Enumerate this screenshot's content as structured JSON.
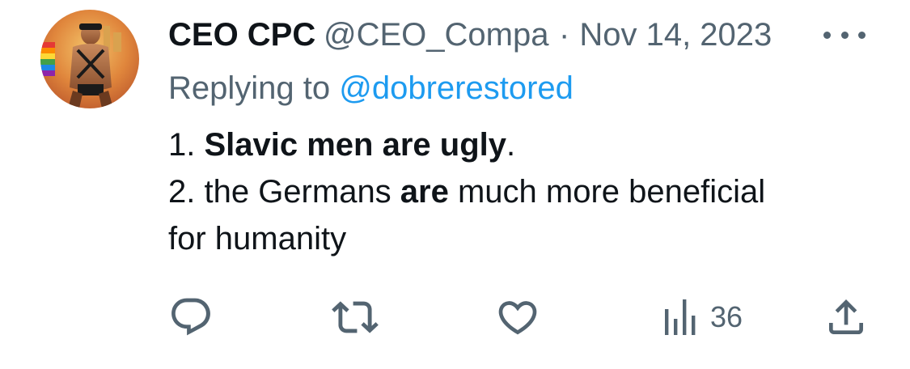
{
  "tweet": {
    "display_name": "CEO CPC",
    "handle": "@CEO_Compa",
    "separator": "·",
    "date": "Nov 14, 2023",
    "replying_prefix": "Replying to ",
    "replying_to": "@dobrerestored",
    "body": {
      "line1_num": "1. ",
      "line1_bold": "Slavic men are ugly",
      "line1_end": ".",
      "line2_start": "2. the Germans ",
      "line2_bold": "are",
      "line2_end": " much more beneficial",
      "line3": "for humanity"
    }
  },
  "actions": {
    "reply_icon": "reply-icon",
    "retweet_icon": "retweet-icon",
    "like_icon": "heart-icon",
    "views_icon": "views-icon",
    "views_count": "36",
    "share_icon": "share-icon"
  },
  "colors": {
    "text": "#0f1419",
    "secondary": "#536471",
    "link": "#1d9bf0"
  }
}
